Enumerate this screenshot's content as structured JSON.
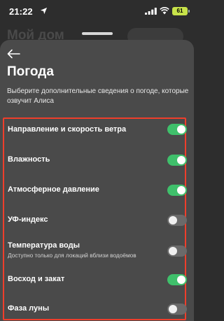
{
  "status_bar": {
    "time": "21:22",
    "battery": "61",
    "icons": [
      "location-arrow-icon",
      "signal-icon",
      "wifi-icon",
      "battery-icon"
    ]
  },
  "background_page": {
    "title": "Мой дом"
  },
  "sheet": {
    "back_icon": "arrow-left-icon",
    "title": "Погода",
    "subtitle": "Выберите дополнительные сведения о погоде, которые озвучит Алиса"
  },
  "settings": [
    {
      "label": "Направление и скорость ветра",
      "note": "",
      "on": true
    },
    {
      "label": "Влажность",
      "note": "",
      "on": true
    },
    {
      "label": "Атмосферное давление",
      "note": "",
      "on": true
    },
    {
      "label": "УФ-индекс",
      "note": "",
      "on": false
    },
    {
      "label": "Температура воды",
      "note": "Доступно только для локаций вблизи водоёмов",
      "on": false
    },
    {
      "label": "Восход и закат",
      "note": "",
      "on": true
    },
    {
      "label": "Фаза луны",
      "note": "",
      "on": false
    }
  ],
  "colors": {
    "accent_border": "#ef3e2b",
    "toggle_on": "#3fc06b",
    "toggle_off": "#6a6a6a",
    "battery": "#c8e34a"
  }
}
